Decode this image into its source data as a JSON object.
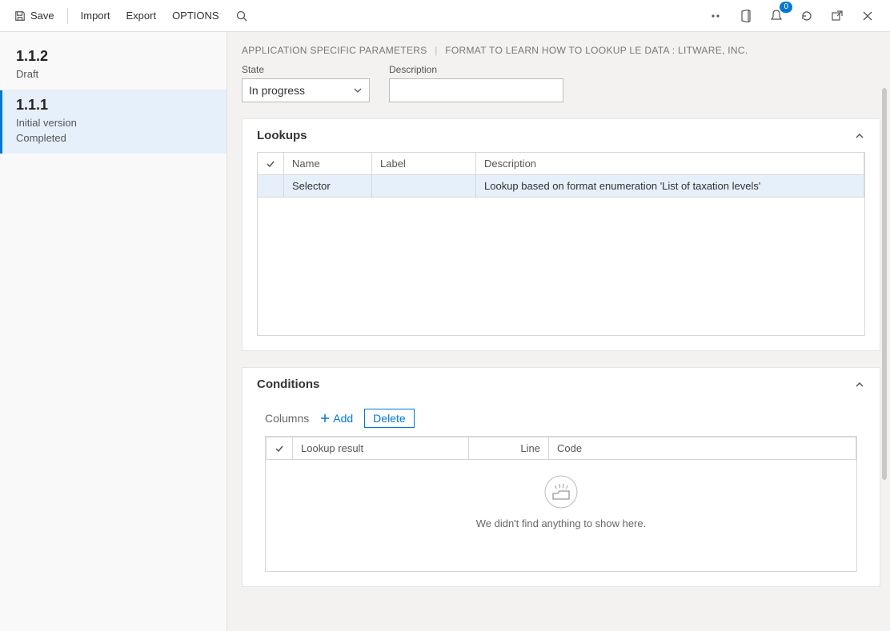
{
  "toolbar": {
    "save": "Save",
    "import": "Import",
    "export": "Export",
    "options": "OPTIONS",
    "badge": "0"
  },
  "sidebar": {
    "versions": [
      {
        "title": "1.1.2",
        "line1": "Draft",
        "line2": ""
      },
      {
        "title": "1.1.1",
        "line1": "Initial version",
        "line2": "Completed"
      }
    ]
  },
  "breadcrumb": {
    "a": "APPLICATION SPECIFIC PARAMETERS",
    "b": "FORMAT TO LEARN HOW TO LOOKUP LE DATA : LITWARE, INC."
  },
  "fields": {
    "stateLabel": "State",
    "stateValue": "In progress",
    "descLabel": "Description",
    "descValue": ""
  },
  "lookups": {
    "title": "Lookups",
    "headers": {
      "name": "Name",
      "label": "Label",
      "description": "Description"
    },
    "rows": [
      {
        "name": "Selector",
        "label": "",
        "description": "Lookup based on format enumeration 'List of taxation levels'"
      }
    ]
  },
  "conditions": {
    "title": "Conditions",
    "toolbar": {
      "columns": "Columns",
      "add": "Add",
      "delete": "Delete"
    },
    "headers": {
      "result": "Lookup result",
      "line": "Line",
      "code": "Code"
    },
    "empty": "We didn't find anything to show here."
  }
}
